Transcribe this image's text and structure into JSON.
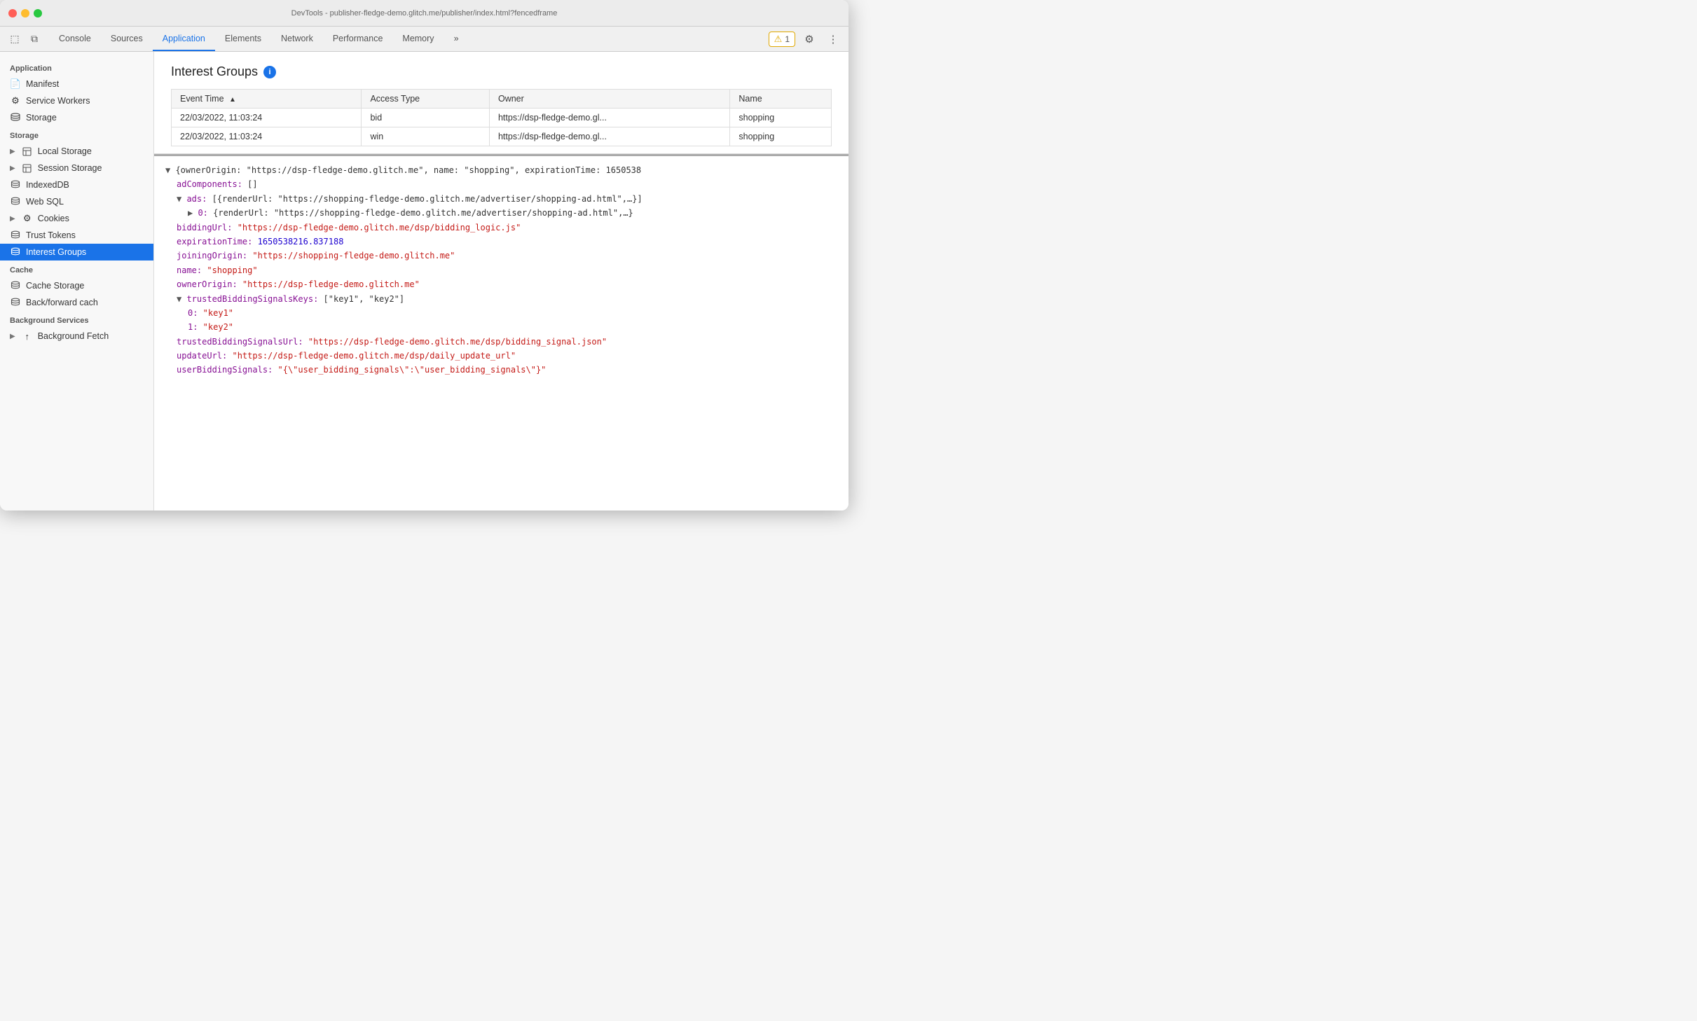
{
  "titlebar": {
    "title": "DevTools - publisher-fledge-demo.glitch.me/publisher/index.html?fencedframe"
  },
  "toolbar": {
    "tabs": [
      {
        "id": "console",
        "label": "Console",
        "active": false
      },
      {
        "id": "sources",
        "label": "Sources",
        "active": false
      },
      {
        "id": "application",
        "label": "Application",
        "active": true
      },
      {
        "id": "elements",
        "label": "Elements",
        "active": false
      },
      {
        "id": "network",
        "label": "Network",
        "active": false
      },
      {
        "id": "performance",
        "label": "Performance",
        "active": false
      },
      {
        "id": "memory",
        "label": "Memory",
        "active": false
      }
    ],
    "more_label": "»",
    "warning_count": "1",
    "settings_icon": "⚙",
    "more_icon": "⋮"
  },
  "sidebar": {
    "application_section": "Application",
    "application_items": [
      {
        "id": "manifest",
        "label": "Manifest",
        "icon": "📄"
      },
      {
        "id": "service-workers",
        "label": "Service Workers",
        "icon": "⚙"
      },
      {
        "id": "storage",
        "label": "Storage",
        "icon": "🗄"
      }
    ],
    "storage_section": "Storage",
    "storage_items": [
      {
        "id": "local-storage",
        "label": "Local Storage",
        "icon": "▦",
        "arrow": "▶"
      },
      {
        "id": "session-storage",
        "label": "Session Storage",
        "icon": "▦",
        "arrow": "▶"
      },
      {
        "id": "indexeddb",
        "label": "IndexedDB",
        "icon": "🗄",
        "arrow": ""
      },
      {
        "id": "web-sql",
        "label": "Web SQL",
        "icon": "🗄",
        "arrow": ""
      },
      {
        "id": "cookies",
        "label": "Cookies",
        "icon": "🍪",
        "arrow": "▶"
      },
      {
        "id": "trust-tokens",
        "label": "Trust Tokens",
        "icon": "🗄",
        "arrow": ""
      },
      {
        "id": "interest-groups",
        "label": "Interest Groups",
        "icon": "🗄",
        "arrow": "",
        "active": true
      }
    ],
    "cache_section": "Cache",
    "cache_items": [
      {
        "id": "cache-storage",
        "label": "Cache Storage",
        "icon": "🗄"
      },
      {
        "id": "back-forward-cache",
        "label": "Back/forward cach",
        "icon": "🗄"
      }
    ],
    "background_section": "Background Services",
    "background_items": [
      {
        "id": "background-fetch",
        "label": "Background Fetch",
        "icon": "↑",
        "arrow": "▶"
      }
    ]
  },
  "content": {
    "title": "Interest Groups",
    "table": {
      "columns": [
        {
          "id": "event-time",
          "label": "Event Time",
          "sorted": true
        },
        {
          "id": "access-type",
          "label": "Access Type"
        },
        {
          "id": "owner",
          "label": "Owner"
        },
        {
          "id": "name",
          "label": "Name"
        }
      ],
      "rows": [
        {
          "event_time": "22/03/2022, 11:03:24",
          "access_type": "bid",
          "owner": "https://dsp-fledge-demo.gl...",
          "name": "shopping"
        },
        {
          "event_time": "22/03/2022, 11:03:24",
          "access_type": "win",
          "owner": "https://dsp-fledge-demo.gl...",
          "name": "shopping"
        }
      ]
    },
    "detail": {
      "lines": [
        {
          "indent": 0,
          "type": "normal",
          "text": "▼ {ownerOrigin: \"https://dsp-fledge-demo.glitch.me\", name: \"shopping\", expirationTime: 1650538"
        },
        {
          "indent": 1,
          "type": "purple-key",
          "text": "adComponents: []"
        },
        {
          "indent": 1,
          "type": "expand",
          "text": "▼ ads: [{renderUrl: \"https://shopping-fledge-demo.glitch.me/advertiser/shopping-ad.html\",…}]"
        },
        {
          "indent": 2,
          "type": "expand",
          "text": "▶ 0: {renderUrl: \"https://shopping-fledge-demo.glitch.me/advertiser/shopping-ad.html\",…}"
        },
        {
          "indent": 1,
          "type": "url-val",
          "text": "biddingUrl: \"https://dsp-fledge-demo.glitch.me/dsp/bidding_logic.js\""
        },
        {
          "indent": 1,
          "type": "number-val",
          "text": "expirationTime: 1650538216.837188"
        },
        {
          "indent": 1,
          "type": "url-val",
          "text": "joiningOrigin: \"https://shopping-fledge-demo.glitch.me\""
        },
        {
          "indent": 1,
          "type": "string-val",
          "text": "name: \"shopping\""
        },
        {
          "indent": 1,
          "type": "url-val",
          "text": "ownerOrigin: \"https://dsp-fledge-demo.glitch.me\""
        },
        {
          "indent": 1,
          "type": "expand",
          "text": "▼ trustedBiddingSignalsKeys: [\"key1\", \"key2\"]"
        },
        {
          "indent": 2,
          "type": "string-val",
          "text": "0: \"key1\""
        },
        {
          "indent": 2,
          "type": "string-val",
          "text": "1: \"key2\""
        },
        {
          "indent": 1,
          "type": "url-val",
          "text": "trustedBiddingSignalsUrl: \"https://dsp-fledge-demo.glitch.me/dsp/bidding_signal.json\""
        },
        {
          "indent": 1,
          "type": "url-val",
          "text": "updateUrl: \"https://dsp-fledge-demo.glitch.me/dsp/daily_update_url\""
        },
        {
          "indent": 1,
          "type": "string-val",
          "text": "userBiddingSignals: \"{\\\"user_bidding_signals\\\":\\\"user_bidding_signals\\\"}\""
        }
      ]
    }
  }
}
